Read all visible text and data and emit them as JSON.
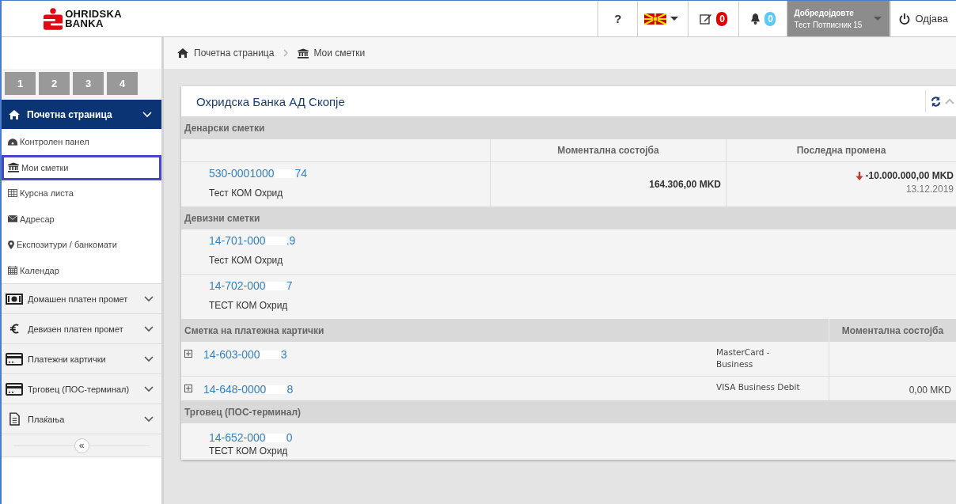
{
  "header": {
    "logo_line1": "OHRIDSKA",
    "logo_line2": "BANKA",
    "help": "?",
    "messages_count": "0",
    "notifications_count": "0",
    "welcome": "Добредојдовте",
    "user": "Тест Потписник 15",
    "logout": "Одјава"
  },
  "sidebar": {
    "tiles": [
      {
        "label": "1"
      },
      {
        "label": "2"
      },
      {
        "label": "3"
      },
      {
        "label": "4"
      }
    ],
    "section": {
      "label": "Почетна страница",
      "expanded": true
    },
    "items": [
      {
        "label": "Контролен панел",
        "kind": "dashboard",
        "selected": false
      },
      {
        "label": "Мои сметки",
        "kind": "bank",
        "selected": true
      },
      {
        "label": "Курсна листа",
        "kind": "table",
        "selected": false
      },
      {
        "label": "Адресар",
        "kind": "mail",
        "selected": false
      },
      {
        "label": "Експозитури / банкомати",
        "kind": "pin",
        "selected": false
      },
      {
        "label": "Календар",
        "kind": "calendar",
        "selected": false
      }
    ],
    "groups": [
      {
        "label": "Домашен платен промет",
        "kind": "money"
      },
      {
        "label": "Девизен платен промет",
        "kind": "euro"
      },
      {
        "label": "Платежни картички",
        "kind": "card"
      },
      {
        "label": "Трговец (ПОС-терминал)",
        "kind": "card"
      },
      {
        "label": "Плаќања",
        "kind": "doc"
      }
    ],
    "collapse": "«"
  },
  "breadcrumb": [
    {
      "label": "Почетна страница",
      "kind": "home"
    },
    {
      "label": "Мои сметки",
      "kind": "bank"
    }
  ],
  "card": {
    "title": "Охридска Банка АД Скопје",
    "sections": [
      {
        "kind": "accounts",
        "title": "Денарски сметки",
        "columns": [
          "Моментална состојба",
          "Последна промена"
        ],
        "rows": [
          {
            "number_start": "530-0001000",
            "number_end": "74",
            "holder": "Тест КОМ Охрид",
            "balance": "164.306,00 MKD",
            "change": "-10.000.000,00 MKD",
            "change_date": "13.12.2019"
          }
        ]
      },
      {
        "kind": "accounts",
        "title": "Девизни сметки",
        "rows": [
          {
            "number_start": "14-701-000",
            "number_end": ".9",
            "holder": "Тест КОМ Охрид"
          },
          {
            "number_start": "14-702-000",
            "number_end": "7",
            "holder": "ТЕСТ КОМ Охрид"
          }
        ]
      },
      {
        "kind": "cards",
        "title": "Сметка на платежна картички",
        "columns": [
          "Моментална состојба"
        ],
        "rows": [
          {
            "number_start": "14-603-000",
            "number_end": "3",
            "card_type": "MasterCard - Business",
            "expanded": false
          },
          {
            "number_start": "14-648-0000",
            "number_end": "8",
            "card_type": "VISA Business Debit",
            "balance": "0,00 MKD",
            "expanded": false
          }
        ]
      },
      {
        "kind": "merchant",
        "title": "Трговец (ПОС-терминал)",
        "rows": [
          {
            "number_start": "14-652-000",
            "number_end": "0",
            "holder": "ТЕСТ КОМ Охрид"
          }
        ]
      }
    ]
  }
}
